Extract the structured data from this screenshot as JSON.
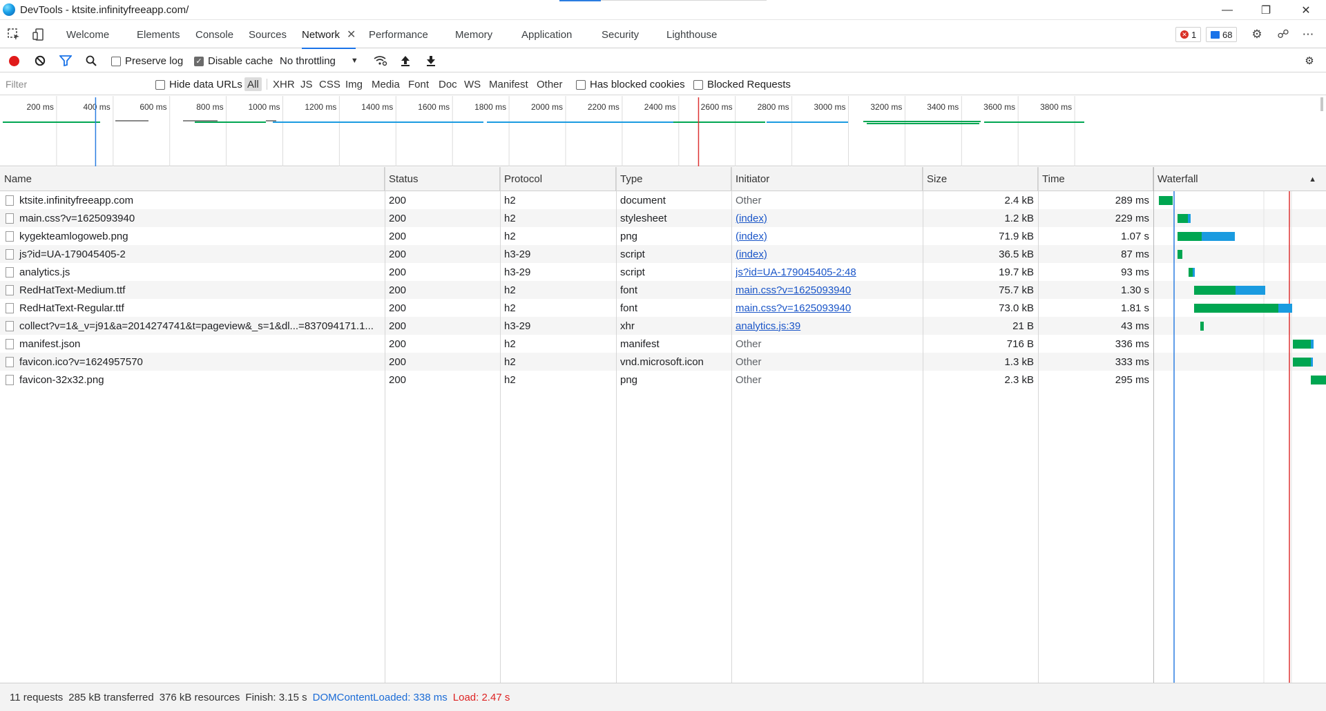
{
  "window": {
    "title": "DevTools - ktsite.infinityfreeapp.com/"
  },
  "tabs": [
    {
      "label": "Welcome"
    },
    {
      "label": "Elements"
    },
    {
      "label": "Console"
    },
    {
      "label": "Sources"
    },
    {
      "label": "Network",
      "active": true
    },
    {
      "label": "Performance"
    },
    {
      "label": "Memory"
    },
    {
      "label": "Application"
    },
    {
      "label": "Security"
    },
    {
      "label": "Lighthouse"
    }
  ],
  "badges": {
    "errors": "1",
    "messages": "68"
  },
  "toolbar": {
    "preserve_log_label": "Preserve log",
    "disable_cache_label": "Disable cache",
    "throttling_value": "No throttling"
  },
  "filter": {
    "placeholder": "Filter",
    "hide_data_urls_label": "Hide data URLs",
    "types": [
      "All",
      "XHR",
      "JS",
      "CSS",
      "Img",
      "Media",
      "Font",
      "Doc",
      "WS",
      "Manifest",
      "Other"
    ],
    "has_blocked_cookies_label": "Has blocked cookies",
    "blocked_requests_label": "Blocked Requests"
  },
  "overview": {
    "ticks": [
      "200 ms",
      "400 ms",
      "600 ms",
      "800 ms",
      "1000 ms",
      "1200 ms",
      "1400 ms",
      "1600 ms",
      "1800 ms",
      "2000 ms",
      "2200 ms",
      "2400 ms",
      "2600 ms",
      "2800 ms",
      "3000 ms",
      "3200 ms",
      "3400 ms",
      "3600 ms",
      "3800 ms"
    ]
  },
  "columns": {
    "name": "Name",
    "status": "Status",
    "protocol": "Protocol",
    "type": "Type",
    "initiator": "Initiator",
    "size": "Size",
    "time": "Time",
    "waterfall": "Waterfall"
  },
  "requests": [
    {
      "name": "ktsite.infinityfreeapp.com",
      "status": "200",
      "protocol": "h2",
      "type": "document",
      "initiator": "Other",
      "initiator_link": false,
      "size": "2.4 kB",
      "time": "289 ms"
    },
    {
      "name": "main.css?v=1625093940",
      "status": "200",
      "protocol": "h2",
      "type": "stylesheet",
      "initiator": "(index)",
      "initiator_link": true,
      "size": "1.2 kB",
      "time": "229 ms"
    },
    {
      "name": "kygekteamlogoweb.png",
      "status": "200",
      "protocol": "h2",
      "type": "png",
      "initiator": "(index)",
      "initiator_link": true,
      "size": "71.9 kB",
      "time": "1.07 s"
    },
    {
      "name": "js?id=UA-179045405-2",
      "status": "200",
      "protocol": "h3-29",
      "type": "script",
      "initiator": "(index)",
      "initiator_link": true,
      "size": "36.5 kB",
      "time": "87 ms"
    },
    {
      "name": "analytics.js",
      "status": "200",
      "protocol": "h3-29",
      "type": "script",
      "initiator": "js?id=UA-179045405-2:48",
      "initiator_link": true,
      "size": "19.7 kB",
      "time": "93 ms"
    },
    {
      "name": "RedHatText-Medium.ttf",
      "status": "200",
      "protocol": "h2",
      "type": "font",
      "initiator": "main.css?v=1625093940",
      "initiator_link": true,
      "size": "75.7 kB",
      "time": "1.30 s"
    },
    {
      "name": "RedHatText-Regular.ttf",
      "status": "200",
      "protocol": "h2",
      "type": "font",
      "initiator": "main.css?v=1625093940",
      "initiator_link": true,
      "size": "73.0 kB",
      "time": "1.81 s"
    },
    {
      "name": "collect?v=1&_v=j91&a=2014274741&t=pageview&_s=1&dl...=837094171.1...",
      "status": "200",
      "protocol": "h3-29",
      "type": "xhr",
      "initiator": "analytics.js:39",
      "initiator_link": true,
      "size": "21 B",
      "time": "43 ms"
    },
    {
      "name": "manifest.json",
      "status": "200",
      "protocol": "h2",
      "type": "manifest",
      "initiator": "Other",
      "initiator_link": false,
      "size": "716 B",
      "time": "336 ms"
    },
    {
      "name": "favicon.ico?v=1624957570",
      "status": "200",
      "protocol": "h2",
      "type": "vnd.microsoft.icon",
      "initiator": "Other",
      "initiator_link": false,
      "size": "1.3 kB",
      "time": "333 ms"
    },
    {
      "name": "favicon-32x32.png",
      "status": "200",
      "protocol": "h2",
      "type": "png",
      "initiator": "Other",
      "initiator_link": false,
      "size": "2.3 kB",
      "time": "295 ms"
    }
  ],
  "colors": {
    "waiting": "#00a651",
    "download": "#1a9be0",
    "dom_line": "#2a7de1",
    "load_line": "#d33"
  },
  "statusbar": {
    "requests": "11 requests",
    "transferred": "285 kB transferred",
    "resources": "376 kB resources",
    "finish": "Finish: 3.15 s",
    "dom_content_loaded": "DOMContentLoaded: 338 ms",
    "load": "Load: 2.47 s"
  }
}
